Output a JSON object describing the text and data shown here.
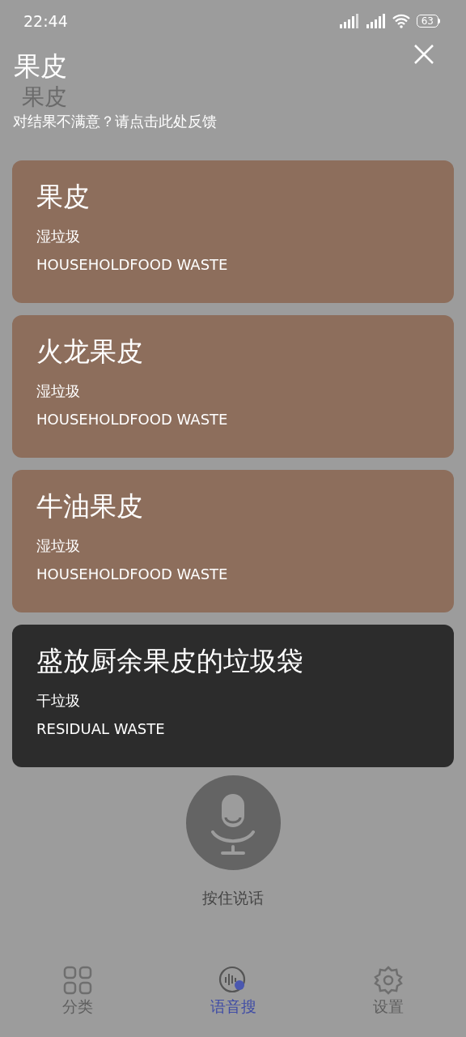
{
  "status_bar": {
    "time": "22:44",
    "battery": "63"
  },
  "header": {
    "title": "果皮",
    "query_echo": "果皮",
    "feedback_link": "对结果不满意？请点击此处反馈"
  },
  "results": [
    {
      "name": "果皮",
      "category": "湿垃圾",
      "category_en": "HOUSEHOLDFOOD WASTE",
      "color": "#8d6e5c"
    },
    {
      "name": "火龙果皮",
      "category": "湿垃圾",
      "category_en": "HOUSEHOLDFOOD WASTE",
      "color": "#8d6e5c"
    },
    {
      "name": "牛油果皮",
      "category": "湿垃圾",
      "category_en": "HOUSEHOLDFOOD WASTE",
      "color": "#8d6e5c"
    },
    {
      "name": "盛放厨余果皮的垃圾袋",
      "category": "干垃圾",
      "category_en": "RESIDUAL WASTE",
      "color": "#2c2c2c"
    }
  ],
  "voice_button": {
    "label": "按住说话"
  },
  "bottom_nav": [
    {
      "kind": "grid",
      "label": "分类",
      "selected": false
    },
    {
      "kind": "voice",
      "label": "语音搜",
      "selected": true
    },
    {
      "kind": "gear",
      "label": "设置",
      "selected": false
    }
  ]
}
